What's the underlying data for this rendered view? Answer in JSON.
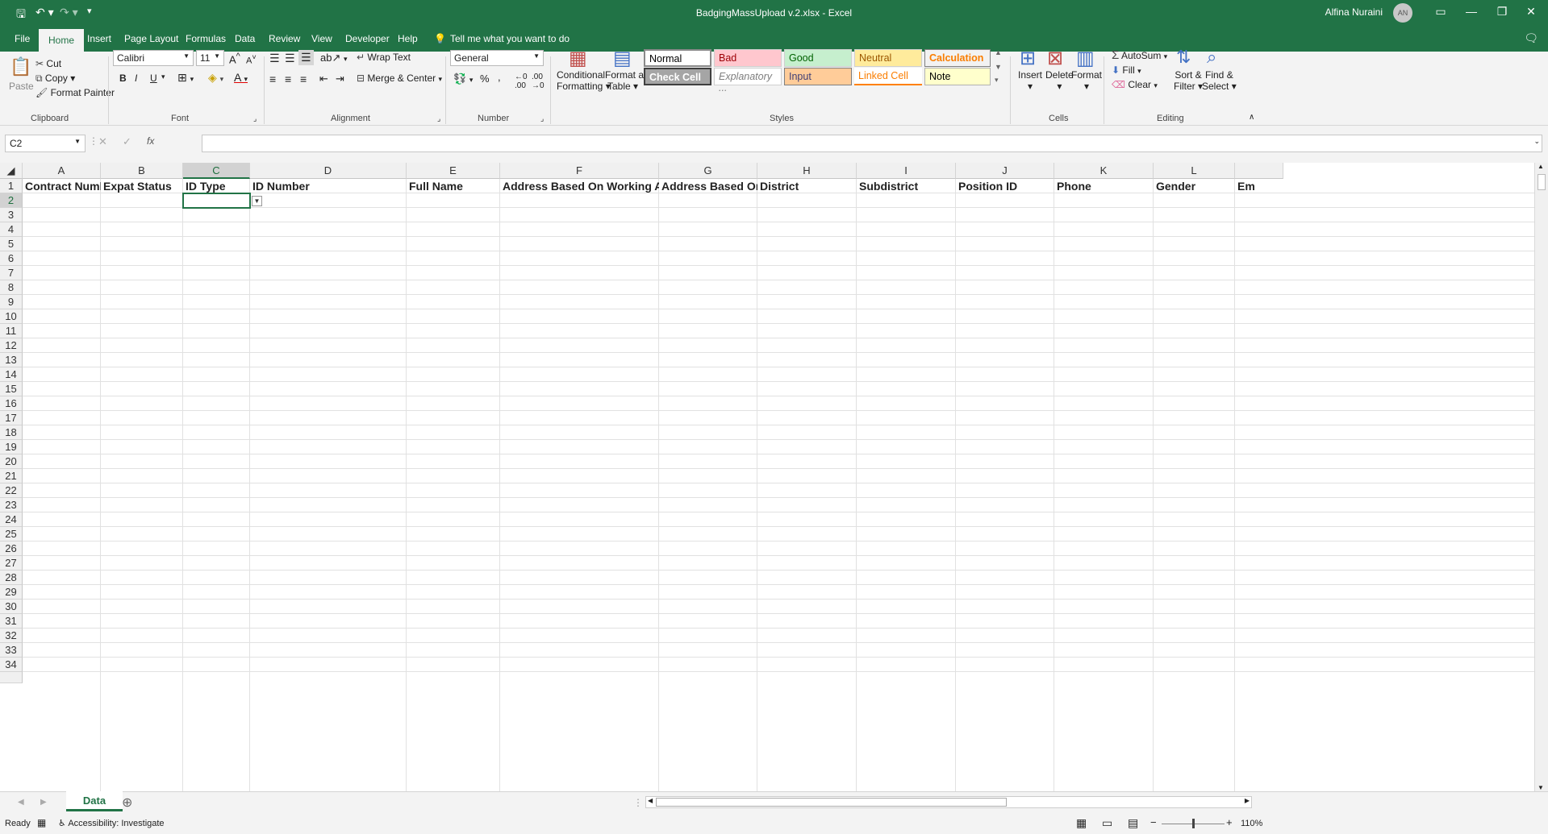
{
  "title": "BadgingMassUpload v.2.xlsx  -  Excel",
  "user": {
    "name": "Alfina Nuraini",
    "initials": "AN"
  },
  "tabs": [
    "File",
    "Home",
    "Insert",
    "Page Layout",
    "Formulas",
    "Data",
    "Review",
    "View",
    "Developer",
    "Help"
  ],
  "tell_me": "Tell me what you want to do",
  "ribbon": {
    "clipboard": {
      "paste": "Paste",
      "cut": "Cut",
      "copy": "Copy",
      "format_painter": "Format Painter",
      "label": "Clipboard"
    },
    "font": {
      "name": "Calibri",
      "size": "11",
      "label": "Font",
      "bold": "B",
      "italic": "I",
      "underline": "U"
    },
    "alignment": {
      "wrap": "Wrap Text",
      "merge": "Merge & Center",
      "label": "Alignment"
    },
    "number": {
      "format": "General",
      "label": "Number",
      "percent": "%"
    },
    "styles": {
      "cond": "Conditional",
      "cond2": "Formatting",
      "fmt_table": "Format as",
      "fmt_table2": "Table",
      "label": "Styles",
      "items": [
        {
          "text": "Normal",
          "bg": "#ffffff",
          "fg": "#000000"
        },
        {
          "text": "Bad",
          "bg": "#ffc7ce",
          "fg": "#9c0006"
        },
        {
          "text": "Good",
          "bg": "#c6efce",
          "fg": "#006100"
        },
        {
          "text": "Neutral",
          "bg": "#ffeb9c",
          "fg": "#9c5700"
        },
        {
          "text": "Calculation",
          "bg": "#f2f2f2",
          "fg": "#fa7d00"
        },
        {
          "text": "Check Cell",
          "bg": "#a5a5a5",
          "fg": "#ffffff"
        },
        {
          "text": "Explanatory ...",
          "bg": "#ffffff",
          "fg": "#7f7f7f"
        },
        {
          "text": "Input",
          "bg": "#ffcc99",
          "fg": "#3f3f76"
        },
        {
          "text": "Linked Cell",
          "bg": "#ffffff",
          "fg": "#fa7d00"
        },
        {
          "text": "Note",
          "bg": "#ffffcc",
          "fg": "#000000"
        }
      ]
    },
    "cells": {
      "insert": "Insert",
      "delete": "Delete",
      "format": "Format",
      "label": "Cells"
    },
    "editing": {
      "autosum": "AutoSum",
      "fill": "Fill",
      "clear": "Clear",
      "sort": "Sort &",
      "sort2": "Filter",
      "find": "Find &",
      "find2": "Select",
      "label": "Editing"
    }
  },
  "name_box": "C2",
  "columns": [
    "A",
    "B",
    "C",
    "D",
    "E",
    "F",
    "G",
    "H",
    "I",
    "J",
    "K",
    "L"
  ],
  "headers": [
    "Contract Number",
    "Expat Status",
    "ID Type",
    "ID Number",
    "Full Name",
    "Address Based On Working Area",
    "Address Based On ID",
    "District",
    "Subdistrict",
    "Position ID",
    "Phone",
    "Gender",
    "Em"
  ],
  "rows": [
    "1",
    "2",
    "3",
    "4",
    "5",
    "6",
    "7",
    "8",
    "9",
    "10",
    "11",
    "12",
    "13",
    "14",
    "15",
    "16",
    "17",
    "18",
    "19",
    "20",
    "21",
    "22",
    "23",
    "24",
    "25",
    "26",
    "27",
    "28",
    "29",
    "30",
    "31",
    "32",
    "33",
    "34"
  ],
  "sheet": "Data",
  "status": {
    "ready": "Ready",
    "accessibility": "Accessibility: Investigate",
    "zoom": "110%"
  }
}
